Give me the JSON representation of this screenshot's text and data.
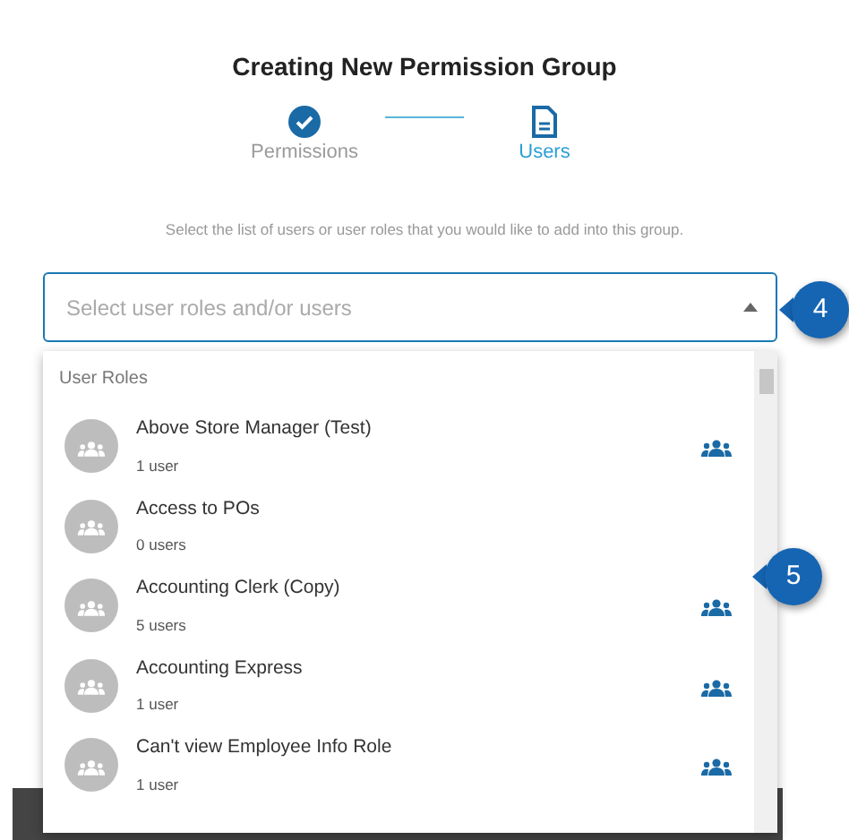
{
  "title": "Creating New Permission Group",
  "steps": [
    {
      "label": "Permissions",
      "kind": "done",
      "selected": false
    },
    {
      "label": "Users",
      "kind": "doc",
      "selected": true
    }
  ],
  "description": "Select the list of users or user roles that you would like to add into this group.",
  "select": {
    "placeholder": "Select user roles and/or users",
    "expanded": true
  },
  "dropdown": {
    "header": "User Roles",
    "items": [
      {
        "name": "Above Store Manager (Test)",
        "count": "1 user",
        "group_icon": true
      },
      {
        "name": "Access to POs",
        "count": "0 users",
        "group_icon": false
      },
      {
        "name": "Accounting Clerk (Copy)",
        "count": "5 users",
        "group_icon": true
      },
      {
        "name": "Accounting Express",
        "count": "1 user",
        "group_icon": true
      },
      {
        "name": "Can't view Employee Info Role",
        "count": "1 user",
        "group_icon": true
      }
    ]
  },
  "callouts": [
    {
      "number": "4"
    },
    {
      "number": "5"
    }
  ]
}
